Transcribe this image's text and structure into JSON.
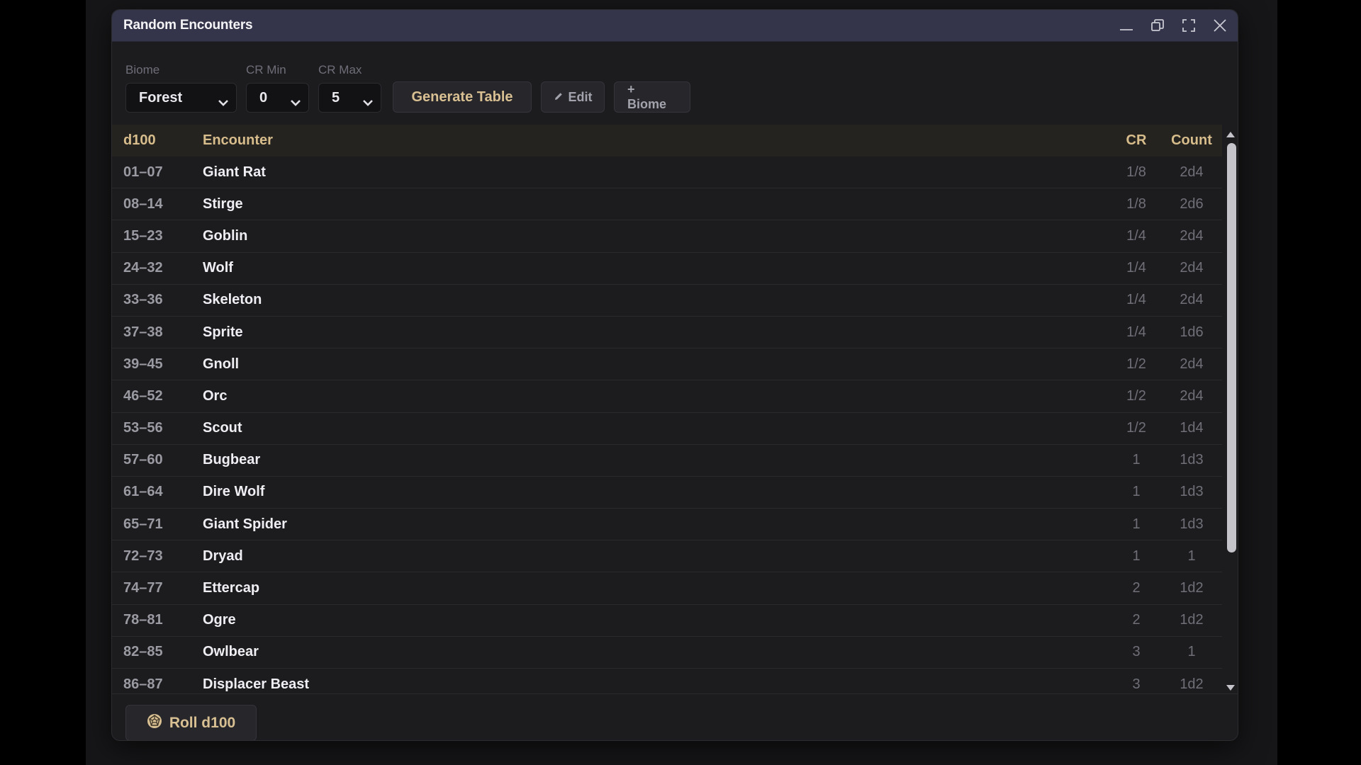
{
  "window": {
    "title": "Random Encounters"
  },
  "toolbar": {
    "biome_label": "Biome",
    "biome_value": "Forest",
    "crmin_label": "CR Min",
    "crmin_value": "0",
    "crmax_label": "CR Max",
    "crmax_value": "5",
    "generate_label": "Generate Table",
    "edit_label": "Edit",
    "add_biome_label": "+ Biome"
  },
  "table": {
    "headers": {
      "d100": "d100",
      "encounter": "Encounter",
      "cr": "CR",
      "count": "Count"
    },
    "rows": [
      {
        "range": "01–07",
        "name": "Giant Rat",
        "cr": "1/8",
        "count": "2d4"
      },
      {
        "range": "08–14",
        "name": "Stirge",
        "cr": "1/8",
        "count": "2d6"
      },
      {
        "range": "15–23",
        "name": "Goblin",
        "cr": "1/4",
        "count": "2d4"
      },
      {
        "range": "24–32",
        "name": "Wolf",
        "cr": "1/4",
        "count": "2d4"
      },
      {
        "range": "33–36",
        "name": "Skeleton",
        "cr": "1/4",
        "count": "2d4"
      },
      {
        "range": "37–38",
        "name": "Sprite",
        "cr": "1/4",
        "count": "1d6"
      },
      {
        "range": "39–45",
        "name": "Gnoll",
        "cr": "1/2",
        "count": "2d4"
      },
      {
        "range": "46–52",
        "name": "Orc",
        "cr": "1/2",
        "count": "2d4"
      },
      {
        "range": "53–56",
        "name": "Scout",
        "cr": "1/2",
        "count": "1d4"
      },
      {
        "range": "57–60",
        "name": "Bugbear",
        "cr": "1",
        "count": "1d3"
      },
      {
        "range": "61–64",
        "name": "Dire Wolf",
        "cr": "1",
        "count": "1d3"
      },
      {
        "range": "65–71",
        "name": "Giant Spider",
        "cr": "1",
        "count": "1d3"
      },
      {
        "range": "72–73",
        "name": "Dryad",
        "cr": "1",
        "count": "1"
      },
      {
        "range": "74–77",
        "name": "Ettercap",
        "cr": "2",
        "count": "1d2"
      },
      {
        "range": "78–81",
        "name": "Ogre",
        "cr": "2",
        "count": "1d2"
      },
      {
        "range": "82–85",
        "name": "Owlbear",
        "cr": "3",
        "count": "1"
      },
      {
        "range": "86–87",
        "name": "Displacer Beast",
        "cr": "3",
        "count": "1d2"
      }
    ]
  },
  "footer": {
    "roll_label": "Roll d100"
  },
  "icons": {
    "minimize": "minimize-icon",
    "restore": "restore-icon",
    "maximize": "maximize-icon",
    "close": "close-icon",
    "edit": "pencil-icon",
    "roll": "dice-icon"
  },
  "colors": {
    "accent_gold": "#d9c093",
    "header_gold": "#d8bd8c",
    "titlebar": "#34344a",
    "window_bg": "#1c1c1f"
  }
}
